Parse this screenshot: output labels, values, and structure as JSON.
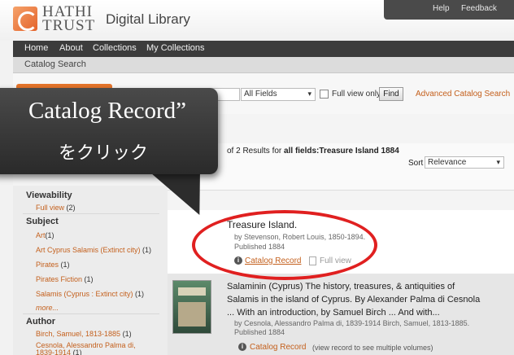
{
  "utility": {
    "help": "Help",
    "feedback": "Feedback"
  },
  "header": {
    "logo_hathi": "HATHI",
    "logo_trust": "TRUST",
    "logo_subtitle": "Digital Library"
  },
  "nav": {
    "items": [
      "Home",
      "About",
      "Collections",
      "My Collections"
    ]
  },
  "subheader": {
    "title": "Catalog Search"
  },
  "search": {
    "field_value": "All Fields",
    "fullview_label": "Full view only",
    "find_label": "Find",
    "advanced_link": "Advanced Catalog Search"
  },
  "results": {
    "count_text": "of 2 Results for",
    "query_text": "all fields:Treasure Island 1884",
    "sort_label": "Sort",
    "sort_value": "Relevance"
  },
  "sidebar": {
    "viewability_head": "Viewability",
    "viewability_items": [
      {
        "label": "Full view",
        "count": "(2)"
      }
    ],
    "subject_head": "Subject",
    "subject_items": [
      {
        "label": "Art",
        "count": "(1)"
      },
      {
        "label": "Art Cyprus Salamis (Extinct city)",
        "count": "(1)"
      },
      {
        "label": "Pirates",
        "count": "(1)"
      },
      {
        "label": "Pirates Fiction",
        "count": "(1)"
      },
      {
        "label": "Salamis (Cyprus : Extinct city)",
        "count": "(1)"
      }
    ],
    "more_label": "more...",
    "author_head": "Author",
    "author_items": [
      {
        "label": "Birch, Samuel, 1813-1885",
        "count": "(1)"
      },
      {
        "label": "Cesnola, Alessandro Palma di,",
        "count": ""
      },
      {
        "label": "1839-1914",
        "count": "(1)"
      }
    ]
  },
  "records": [
    {
      "title": "Treasure Island.",
      "author": "by Stevenson, Robert Louis, 1850-1894.",
      "published": "Published 1884",
      "catalog_link": "Catalog Record",
      "fullview_link": "Full view"
    },
    {
      "title_lines": [
        "Salaminin (Cyprus) The history, treasures, & antiquities of",
        "Salamis in the island of Cyprus. By Alexander Palma di Cesnola",
        "... With an introduction, by Samuel Birch ... And with..."
      ],
      "author": "by Cesnola, Alessandro Palma di, 1839-1914 Birch, Samuel, 1813-1885.",
      "published": "Published 1884",
      "catalog_link": "Catalog Record",
      "multi_note": "(view record to see multiple volumes)"
    }
  ],
  "callout": {
    "line1": "Catalog Record”",
    "line2": "をクリック"
  },
  "colors": {
    "accent": "#c4601d",
    "nav_bg": "#3c3c3c",
    "highlight": "#e02020",
    "orange_tab": "#e4742b"
  }
}
